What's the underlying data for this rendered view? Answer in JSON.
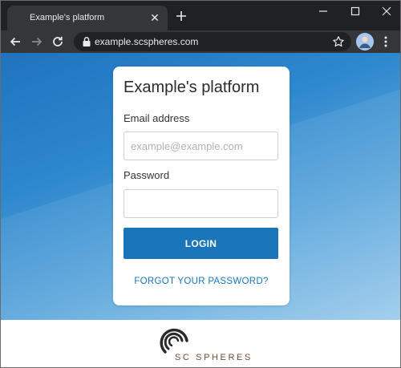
{
  "browser": {
    "tab_title": "Example's platform",
    "tab_close": "✕",
    "url": "example.scspheres.com"
  },
  "login": {
    "title": "Example's platform",
    "email_label": "Email address",
    "email_placeholder": "example@example.com",
    "email_value": "",
    "password_label": "Password",
    "password_value": "",
    "login_button": "LOGIN",
    "forgot_link": "FORGOT YOUR PASSWORD?"
  },
  "footer": {
    "logo_text": "SC SPHERES"
  },
  "colors": {
    "accent": "#1a75bb",
    "logo": "#7a4a33"
  },
  "icons": {
    "back": "arrow-left-icon",
    "forward": "arrow-right-icon",
    "reload": "reload-icon",
    "lock": "lock-icon",
    "bookmark": "star-icon",
    "menu": "kebab-menu-icon",
    "new_tab": "plus-icon"
  }
}
